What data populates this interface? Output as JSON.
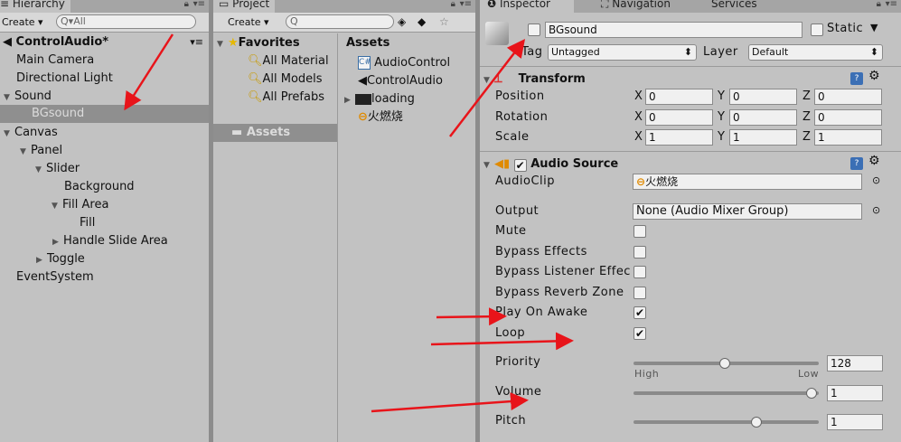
{
  "hierarchy": {
    "tab_label": "Hierarchy",
    "create_label": "Create",
    "search_placeholder": "All",
    "scene_name": "ControlAudio*",
    "items": [
      {
        "label": "Main Camera"
      },
      {
        "label": "Directional Light"
      },
      {
        "label": "Sound"
      },
      {
        "label": "BGsound"
      },
      {
        "label": "Canvas"
      },
      {
        "label": "Panel"
      },
      {
        "label": "Slider"
      },
      {
        "label": "Background"
      },
      {
        "label": "Fill Area"
      },
      {
        "label": "Fill"
      },
      {
        "label": "Handle Slide Area"
      },
      {
        "label": "Toggle"
      },
      {
        "label": "EventSystem"
      }
    ]
  },
  "project": {
    "tab_label": "Project",
    "create_label": "Create",
    "favorites_label": "Favorites",
    "favorites": [
      "All Material",
      "All Models",
      "All Prefabs"
    ],
    "assets_folder": "Assets",
    "assets_header": "Assets",
    "assets": [
      "AudioControl",
      "ControlAudio",
      "loading",
      "火燃烧"
    ]
  },
  "inspector": {
    "tabs": [
      "Inspector",
      "Navigation",
      "Services"
    ],
    "object_name": "BGsound",
    "static_label": "Static",
    "tag_label": "Tag",
    "tag_value": "Untagged",
    "layer_label": "Layer",
    "layer_value": "Default",
    "transform": {
      "title": "Transform",
      "position_label": "Position",
      "rotation_label": "Rotation",
      "scale_label": "Scale",
      "position": [
        "0",
        "0",
        "0"
      ],
      "rotation": [
        "0",
        "0",
        "0"
      ],
      "scale": [
        "1",
        "1",
        "1"
      ]
    },
    "audio": {
      "title": "Audio Source",
      "clip_label": "AudioClip",
      "clip_value": "火燃烧",
      "output_label": "Output",
      "output_value": "None (Audio Mixer Group)",
      "mute_label": "Mute",
      "bypass_effects_label": "Bypass Effects",
      "bypass_listener_label": "Bypass Listener Effec",
      "bypass_reverb_label": "Bypass Reverb Zone",
      "play_on_awake_label": "Play On Awake",
      "loop_label": "Loop",
      "priority_label": "Priority",
      "priority_value": "128",
      "priority_level": 0.5,
      "high_label": "High",
      "low_label": "Low",
      "volume_label": "Volume",
      "volume_value": "1",
      "volume_level": 1.0,
      "pitch_label": "Pitch",
      "pitch_value": "1",
      "checked_mark": "✔"
    }
  },
  "colors": {
    "annotation_arrow": "#e8141a",
    "panel_bg": "#c2c2c2",
    "selection": "#8f8f8f"
  }
}
